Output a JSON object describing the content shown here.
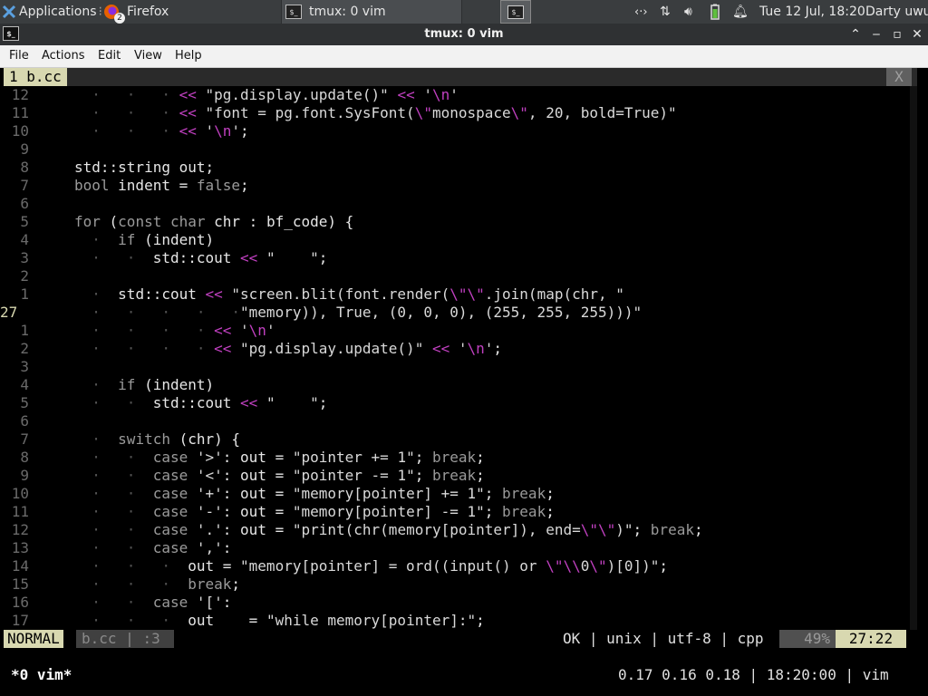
{
  "panel": {
    "applications": "Applications",
    "firefox": "Firefox",
    "firefox_badge": "2",
    "task_tmux": "tmux: 0 vim",
    "clock": "Tue 12 Jul, 18:20",
    "user": "Darty uwu"
  },
  "window": {
    "title": "tmux: 0 vim"
  },
  "menu": {
    "file": "File",
    "actions": "Actions",
    "edit": "Edit",
    "view": "View",
    "help": "Help"
  },
  "vim": {
    "tab_label": "1 b.cc",
    "tab_close": "X",
    "lines": [
      {
        "n": "12",
        "code": "  .   .   . << \"pg.display.update()\" << '\\n'"
      },
      {
        "n": "11",
        "code": "  .   .   . << \"font = pg.font.SysFont(\\\"monospace\\\", 20, bold=True)\""
      },
      {
        "n": "10",
        "code": "  .   .   . << '\\n';"
      },
      {
        "n": "9",
        "code": ""
      },
      {
        "n": "8",
        "code": "std::string out;"
      },
      {
        "n": "7",
        "code": "bool indent = false;"
      },
      {
        "n": "6",
        "code": ""
      },
      {
        "n": "5",
        "code": "for (const char chr : bf_code) {"
      },
      {
        "n": "4",
        "code": "  .  if (indent)"
      },
      {
        "n": "3",
        "code": "  .   .  std::cout << \"    \";"
      },
      {
        "n": "2",
        "code": ""
      },
      {
        "n": "1",
        "code": "  .  std::cout << \"screen.blit(font.render(\\\"\\\".join(map(chr, \""
      },
      {
        "n": "27",
        "code": "  .   .   .   .   .\"memory)), True, (0, 0, 0), (255, 255, 255)))\""
      },
      {
        "n": "1",
        "code": "  .   .   .   . << '\\n'"
      },
      {
        "n": "2",
        "code": "  .   .   .   . << \"pg.display.update()\" << '\\n';"
      },
      {
        "n": "3",
        "code": ""
      },
      {
        "n": "4",
        "code": "  .  if (indent)"
      },
      {
        "n": "5",
        "code": "  .   .  std::cout << \"    \";"
      },
      {
        "n": "6",
        "code": ""
      },
      {
        "n": "7",
        "code": "  .  switch (chr) {"
      },
      {
        "n": "8",
        "code": "  .   .  case '>': out = \"pointer += 1\"; break;"
      },
      {
        "n": "9",
        "code": "  .   .  case '<': out = \"pointer -= 1\"; break;"
      },
      {
        "n": "10",
        "code": "  .   .  case '+': out = \"memory[pointer] += 1\"; break;"
      },
      {
        "n": "11",
        "code": "  .   .  case '-': out = \"memory[pointer] -= 1\"; break;"
      },
      {
        "n": "12",
        "code": "  .   .  case '.': out = \"print(chr(memory[pointer]), end=\\\"\\\")\"; break;"
      },
      {
        "n": "13",
        "code": "  .   .  case ',':"
      },
      {
        "n": "14",
        "code": "  .   .   .  out = \"memory[pointer] = ord((input() or \\\"\\\\0\\\")[0])\";"
      },
      {
        "n": "15",
        "code": "  .   .   .  break;"
      },
      {
        "n": "16",
        "code": "  .   .  case '[':"
      },
      {
        "n": "17",
        "code": "  .   .   .  out    = \"while memory[pointer]:\";"
      }
    ],
    "status": {
      "mode": "NORMAL",
      "file": "b.cc",
      "sep": "|",
      "pos_short": ":3",
      "info": "OK | unix | utf-8 | cpp",
      "percent": "49%",
      "position": "27:22"
    }
  },
  "tmux": {
    "window": "*0 vim*",
    "right": "0.17 0.16 0.18 | 18:20:00 | vim"
  },
  "colors": {
    "accent": "#c040c0",
    "status_bg": "#d8d8b0",
    "panel_bg": "#3a3d3f"
  }
}
